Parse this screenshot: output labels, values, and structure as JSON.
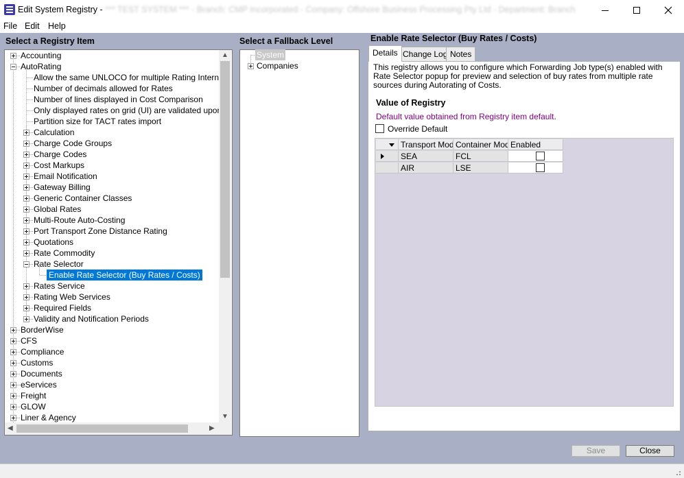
{
  "window": {
    "title": "Edit System Registry - ",
    "title_obscured": "*** TEST SYSTEM *** - Branch: CMP Incorporated - Company: Offshore Business Processing Pty Ltd - Department: Branch"
  },
  "menu": [
    "File",
    "Edit",
    "Help"
  ],
  "registry_panel": {
    "heading": "Select a Registry Item",
    "top_items": [
      "Accounting",
      "AutoRating"
    ],
    "auto_leaves": [
      "Allow the same UNLOCO for multiple Rating International",
      "Number of decimals allowed for Rates",
      "Number of lines displayed in Cost Comparison",
      "Only displayed rates on grid (UI) are validated upon saving",
      "Partition size for TACT rates import"
    ],
    "auto_groups_a": [
      "Calculation",
      "Charge Code Groups",
      "Charge Codes",
      "Cost Markups",
      "Email Notification",
      "Gateway Billing",
      "Generic Container Classes",
      "Global Rates",
      "Multi-Route Auto-Costing",
      "Port Transport Zone Distance Rating",
      "Quotations",
      "Rate Commodity"
    ],
    "rate_selector": "Rate Selector",
    "selected_leaf": "Enable Rate Selector (Buy Rates / Costs)",
    "auto_groups_b": [
      "Rates Service",
      "Rating Web Services",
      "Required Fields",
      "Validity and Notification Periods"
    ],
    "bottom_items": [
      "BorderWise",
      "CFS",
      "Compliance",
      "Customs",
      "Documents",
      "eServices",
      "Freight",
      "GLOW",
      "Liner & Agency"
    ]
  },
  "fallback_panel": {
    "heading": "Select a Fallback Level",
    "items": [
      "System",
      "Companies"
    ]
  },
  "detail_panel": {
    "heading": "Enable Rate Selector (Buy Rates / Costs)",
    "tabs": [
      "Details",
      "Change Log",
      "Notes"
    ],
    "description": "This registry allows you to configure which Forwarding Job type(s) enabled with Rate Selector popup for preview and selection of buy rates from multiple rate sources during Autorating of Costs.",
    "value_title": "Value of Registry",
    "default_text": "Default value obtained from Registry item default.",
    "override_label": "Override Default",
    "override_checked": false,
    "grid": {
      "columns": [
        "Transport Mode",
        "Container Mode",
        "Enabled"
      ],
      "rows": [
        {
          "transport": "SEA",
          "container": "FCL",
          "enabled": false
        },
        {
          "transport": "AIR",
          "container": "LSE",
          "enabled": false
        }
      ]
    }
  },
  "buttons": {
    "save": "Save",
    "close": "Close"
  },
  "colors": {
    "selection": "#0078d7",
    "default_text": "#800080",
    "background": "#a9b0c6"
  }
}
